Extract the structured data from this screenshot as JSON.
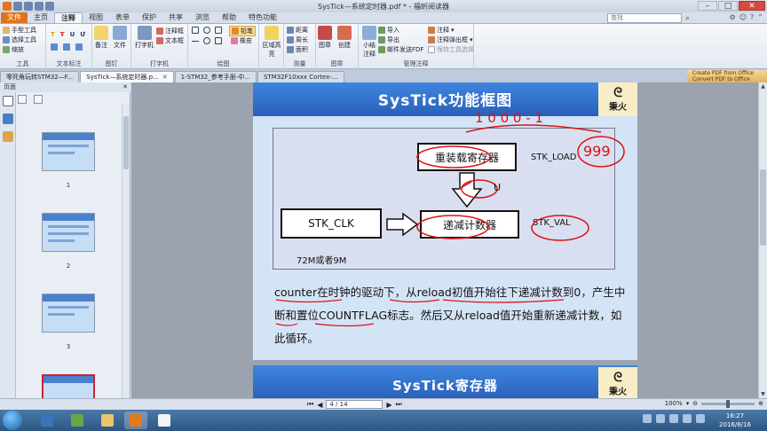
{
  "window": {
    "title": "SysTick—系统定时器.pdf * - 福昕阅读器"
  },
  "ribbon_tabs": [
    "文件",
    "主页",
    "注释",
    "视图",
    "表单",
    "保护",
    "共享",
    "浏览",
    "帮助",
    "特色功能"
  ],
  "search": {
    "placeholder": "查找"
  },
  "ribbon": {
    "tools": {
      "hand": "手型工具",
      "select": "选择工具",
      "zoom": "缩放",
      "label": "工具"
    },
    "text_markup": {
      "label": "文本标注"
    },
    "pin": {
      "note": "备注",
      "file": "文件",
      "label": "图钉"
    },
    "typewriter": {
      "typewriter": "打字机",
      "callout": "注释框",
      "textbox": "文本框",
      "label": "打字机"
    },
    "drawing": {
      "pencil": "铅笔",
      "eraser": "橡皮",
      "area_highlight": "区域高亮",
      "label": "绘图"
    },
    "measure": {
      "distance": "距离",
      "perimeter": "周长",
      "area": "面积",
      "label": "测量"
    },
    "stamp": {
      "stamp": "图章",
      "create": "创建",
      "label": "图章"
    },
    "manage": {
      "summarize": "小结注释",
      "import": "导入",
      "export": "导出",
      "email_fdf": "邮件发送FDF",
      "annotate": "注释",
      "popup": "注释弹出框",
      "keep_tool": "保持工具选择",
      "label": "管理注释"
    }
  },
  "doc_tabs": [
    {
      "label": "零死角玩转STM32—F..."
    },
    {
      "label": "SysTick—系统定时器.p..."
    },
    {
      "label": "1-STM32_参考手册-中..."
    },
    {
      "label": "STM32F10xxx Cortex-..."
    }
  ],
  "promo": {
    "line1": "Create PDF from Office",
    "line2": "Convert PDF to Office"
  },
  "sidebar": {
    "title": "页面",
    "pages": [
      "1",
      "2",
      "3"
    ]
  },
  "slide": {
    "title": "SysTick功能框图",
    "logo_name": "秉火",
    "reload_box": "重装载寄存器",
    "load_label": "STK_LOAD",
    "counter_box": "递减计数器",
    "val_label": "STK_VAL",
    "clk_box": "STK_CLK",
    "clk_note": "72M或者9M",
    "ann_top": "1 0 0 0 - 1",
    "ann_circle": "999",
    "ann_u": "U",
    "paragraph": "counter在时钟的驱动下，从reload初值开始往下递减计数到0，产生中断和置位COUNTFLAG标志。然后又从reload值开始重新递减计数，如此循环。"
  },
  "slide2": {
    "title": "SysTick寄存器",
    "logo_name": "秉火"
  },
  "status": {
    "page": "4 / 14",
    "zoom": "100%"
  },
  "clock": {
    "time": "16:27",
    "date": "2016/8/16"
  }
}
